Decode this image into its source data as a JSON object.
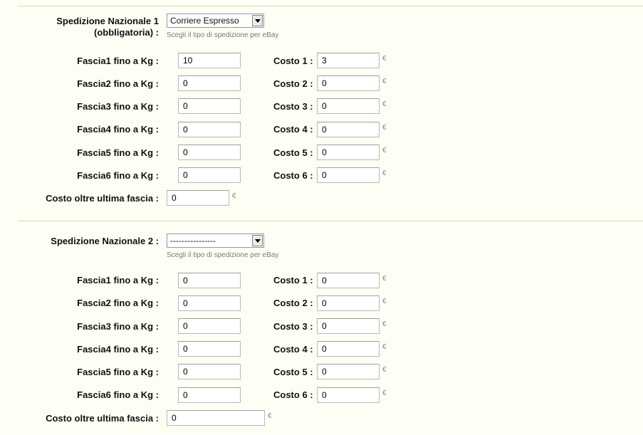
{
  "sections": [
    {
      "title_line1": "Spedizione Nazionale 1",
      "title_line2": "(obbligatoria) :",
      "select_value": "Corriere Espresso",
      "hint": "Scegli il tipo di spedizione per eBay",
      "rows": [
        {
          "fascia_label": "Fascia1 fino a Kg :",
          "fascia_value": "10",
          "costo_label": "Costo 1 :",
          "costo_value": "3"
        },
        {
          "fascia_label": "Fascia2 fino a Kg :",
          "fascia_value": "0",
          "costo_label": "Costo 2 :",
          "costo_value": "0"
        },
        {
          "fascia_label": "Fascia3 fino a Kg :",
          "fascia_value": "0",
          "costo_label": "Costo 3 :",
          "costo_value": "0"
        },
        {
          "fascia_label": "Fascia4 fino a Kg :",
          "fascia_value": "0",
          "costo_label": "Costo 4 :",
          "costo_value": "0"
        },
        {
          "fascia_label": "Fascia5 fino a Kg :",
          "fascia_value": "0",
          "costo_label": "Costo 5 :",
          "costo_value": "0"
        },
        {
          "fascia_label": "Fascia6 fino a Kg :",
          "fascia_value": "0",
          "costo_label": "Costo 6 :",
          "costo_value": "0"
        }
      ],
      "oltre_label": "Costo oltre ultima fascia :",
      "oltre_value": "0"
    },
    {
      "title_line1": "Spedizione Nazionale 2 :",
      "title_line2": "",
      "select_value": "----------------",
      "hint": "Scegli il tipo di spedizione per eBay",
      "rows": [
        {
          "fascia_label": "Fascia1 fino a Kg :",
          "fascia_value": "0",
          "costo_label": "Costo 1 :",
          "costo_value": "0"
        },
        {
          "fascia_label": "Fascia2 fino a Kg :",
          "fascia_value": "0",
          "costo_label": "Costo 2 :",
          "costo_value": "0"
        },
        {
          "fascia_label": "Fascia3 fino a Kg :",
          "fascia_value": "0",
          "costo_label": "Costo 3 :",
          "costo_value": "0"
        },
        {
          "fascia_label": "Fascia4 fino a Kg :",
          "fascia_value": "0",
          "costo_label": "Costo 4 :",
          "costo_value": "0"
        },
        {
          "fascia_label": "Fascia5 fino a Kg :",
          "fascia_value": "0",
          "costo_label": "Costo 5 :",
          "costo_value": "0"
        },
        {
          "fascia_label": "Fascia6 fino a Kg :",
          "fascia_value": "0",
          "costo_label": "Costo 6 :",
          "costo_value": "0"
        }
      ],
      "oltre_label": "Costo oltre ultima fascia :",
      "oltre_value": "0"
    }
  ],
  "currency_symbol": "€"
}
